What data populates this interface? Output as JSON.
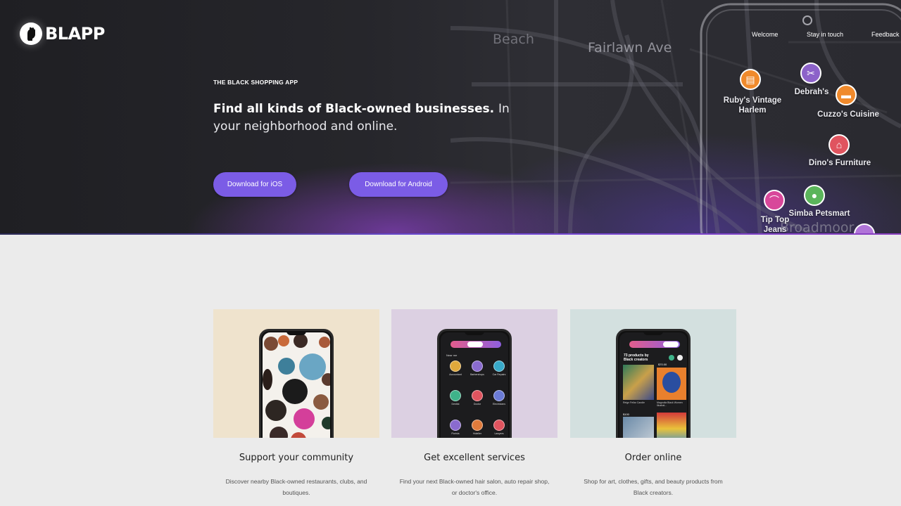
{
  "brand": {
    "name": "BLAPP"
  },
  "nav": {
    "items": [
      "Welcome",
      "Stay in touch",
      "Feedback"
    ]
  },
  "hero": {
    "eyebrow": "THE BLACK SHOPPING APP",
    "headline_bold": "Find all kinds of Black-owned businesses.",
    "headline_rest": "In your neighborhood and online.",
    "buttons": {
      "ios": "Download for iOS",
      "android": "Download for Android"
    }
  },
  "map": {
    "streets": [
      "Beach",
      "Fairlawn Ave",
      "Broadmoor"
    ],
    "pins": [
      {
        "label_line1": "Ruby's Vintage",
        "label_line2": "Harlem",
        "color": "#f08a2c",
        "icon": "storefront-icon"
      },
      {
        "label_line1": "Debrah's",
        "label_line2": "",
        "color": "#8c62c9",
        "icon": "hair-dryer-icon"
      },
      {
        "label_line1": "Cuzzo's Cuisine",
        "label_line2": "",
        "color": "#f08a2c",
        "icon": "food-icon"
      },
      {
        "label_line1": "Dino's Furniture",
        "label_line2": "",
        "color": "#e0545f",
        "icon": "home-icon"
      },
      {
        "label_line1": "Simba Petsmart",
        "label_line2": "",
        "color": "#5bb55b",
        "icon": "dog-icon"
      },
      {
        "label_line1": "Tip Top",
        "label_line2": "Jeans",
        "color": "#d8479a",
        "icon": "hanger-icon"
      }
    ]
  },
  "features": [
    {
      "title": "Support your community",
      "description": "Discover nearby Black-owned restaurants, clubs, and boutiques.",
      "bg": "#efe3cd"
    },
    {
      "title": "Get excellent services",
      "description": "Find your next Black-owned hair salon, auto repair shop, or doctor's office.",
      "bg": "#dcd0e2"
    },
    {
      "title": "Order online",
      "description": "Shop for art, clothes, gifts, and beauty products from Black creators.",
      "bg": "#d3e0df"
    }
  ],
  "phone_screens": {
    "tabs": [
      "Nearby",
      "Services",
      "Products"
    ],
    "services_header": "Near me",
    "services": [
      "Accountant",
      "Barbershops",
      "Car Repairs",
      "Dentist",
      "Doctor",
      "Electricians",
      "Florists",
      "Hotelier",
      "Lawyers"
    ],
    "services_colors": [
      "#e0a93c",
      "#8a6bcf",
      "#38a9c9",
      "#3fb38a",
      "#e0545f",
      "#6b7bd6",
      "#8a6bcf",
      "#e07b3c",
      "#e0545f"
    ],
    "products_header": "73 products by Black creators",
    "prices": [
      "$70.00",
      "$100"
    ],
    "product_captions": [
      "Reign Fellar Candle",
      "Magnolia Black Women Illustrat..."
    ]
  }
}
